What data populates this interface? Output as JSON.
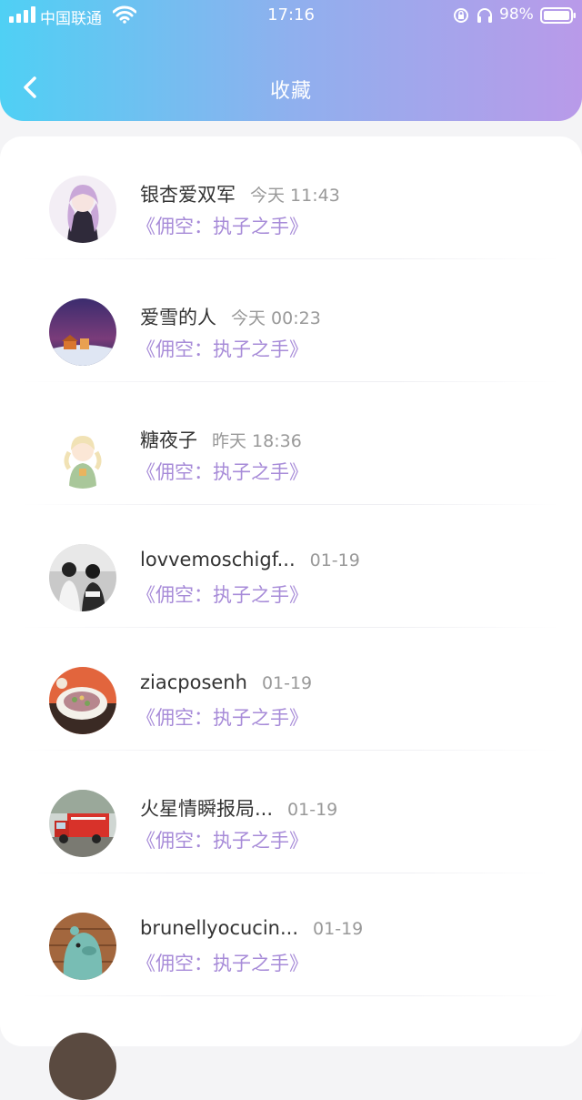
{
  "status_bar": {
    "carrier": "中国联通",
    "time": "17:16",
    "battery": "98%"
  },
  "header": {
    "title": "收藏",
    "back_icon": "chevron-left-icon"
  },
  "colors": {
    "header_gradient_start": "#4fd0f4",
    "header_gradient_end": "#b99ae9",
    "work_title": "#a78bd8",
    "name": "#333333",
    "time": "#999999"
  },
  "favorites": [
    {
      "name": "银杏爱双军",
      "time": "今天 11:43",
      "work": "《佣空：执子之手》"
    },
    {
      "name": "爱雪的人",
      "time": "今天 00:23",
      "work": "《佣空：执子之手》"
    },
    {
      "name": "糖夜子",
      "time": "昨天 18:36",
      "work": "《佣空：执子之手》"
    },
    {
      "name": "lovvemoschigf...",
      "time": "01-19",
      "work": "《佣空：执子之手》"
    },
    {
      "name": "ziacposenh",
      "time": "01-19",
      "work": "《佣空：执子之手》"
    },
    {
      "name": "火星情瞬报局...",
      "time": "01-19",
      "work": "《佣空：执子之手》"
    },
    {
      "name": "brunellyocucin...",
      "time": "01-19",
      "work": "《佣空：执子之手》"
    }
  ]
}
